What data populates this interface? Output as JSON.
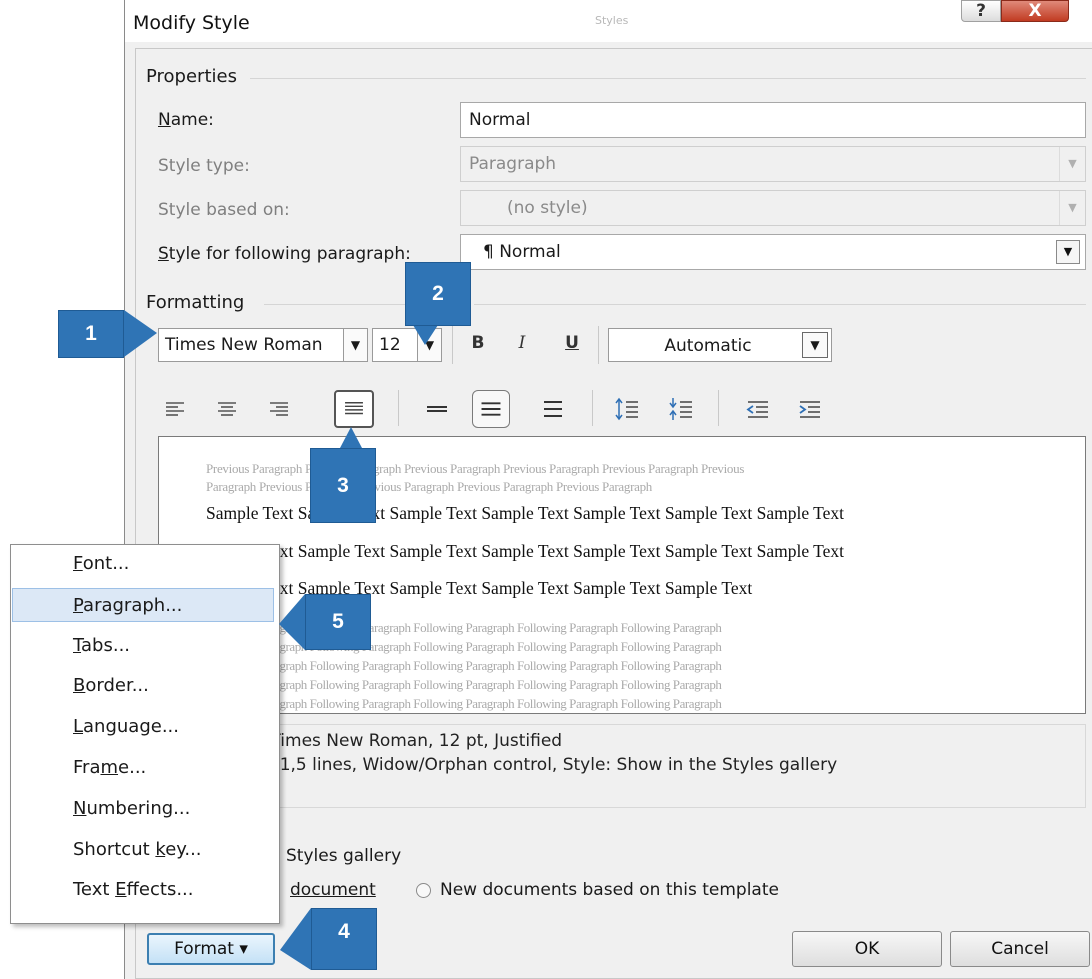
{
  "dialog": {
    "title": "Modify Style",
    "title_ghost": "Styles",
    "help_label": "?",
    "close_label": "X"
  },
  "properties": {
    "heading": "Properties",
    "name_label": "Name:",
    "name_value": "Normal",
    "style_type_label": "Style type:",
    "style_type_value": "Paragraph",
    "based_on_label": "Style based on:",
    "based_on_value": "(no style)",
    "following_label": "Style for following paragraph:",
    "following_value": "¶ Normal"
  },
  "formatting": {
    "heading": "Formatting",
    "font_name": "Times New Roman",
    "font_size": "12",
    "bold": "B",
    "italic": "I",
    "underline": "U",
    "color_value": "Automatic"
  },
  "preview": {
    "previous_lines": [
      "Previous Paragraph Previous Paragraph Previous Paragraph Previous Paragraph Previous Paragraph Previous",
      "Paragraph Previous Paragraph Previous Paragraph Previous Paragraph Previous Paragraph"
    ],
    "sample_lines": [
      "Sample Text Sample Text Sample Text Sample Text Sample Text Sample Text Sample Text",
      "Sample Text Sample Text Sample Text Sample Text Sample Text Sample Text Sample Text",
      "Sample Text Sample Text Sample Text Sample Text Sample Text Sample Text"
    ],
    "following_lines": [
      "Following Paragraph Following Paragraph Following Paragraph Following Paragraph Following Paragraph",
      "Following Paragraph Following Paragraph Following Paragraph Following Paragraph Following Paragraph",
      "Following Paragraph Following Paragraph Following Paragraph Following Paragraph Following Paragraph",
      "Following Paragraph Following Paragraph Following Paragraph Following Paragraph Following Paragraph",
      "Following Paragraph Following Paragraph Following Paragraph Following Paragraph Following Paragraph"
    ]
  },
  "description": {
    "line1": "lt) Times New Roman, 12 pt, Justified",
    "line2": "ng:  1,5 lines, Widow/Orphan control, Style: Show in the Styles gallery"
  },
  "options": {
    "styles_gallery_label": "Styles gallery",
    "only_document_label": "document",
    "new_documents_label": "New documents based on this template"
  },
  "buttons": {
    "format_label": "Format",
    "ok_label": "OK",
    "cancel_label": "Cancel"
  },
  "format_menu": [
    {
      "pre": "",
      "key": "F",
      "post": "ont..."
    },
    {
      "pre": "",
      "key": "P",
      "post": "aragraph..."
    },
    {
      "pre": "",
      "key": "T",
      "post": "abs..."
    },
    {
      "pre": "",
      "key": "B",
      "post": "order..."
    },
    {
      "pre": "",
      "key": "L",
      "post": "anguage..."
    },
    {
      "pre": "Fra",
      "key": "m",
      "post": "e..."
    },
    {
      "pre": "",
      "key": "N",
      "post": "umbering..."
    },
    {
      "pre": "Shortcut ",
      "key": "k",
      "post": "ey..."
    },
    {
      "pre": "Text ",
      "key": "E",
      "post": "ffects..."
    }
  ],
  "callouts": [
    "1",
    "2",
    "3",
    "4",
    "5"
  ]
}
